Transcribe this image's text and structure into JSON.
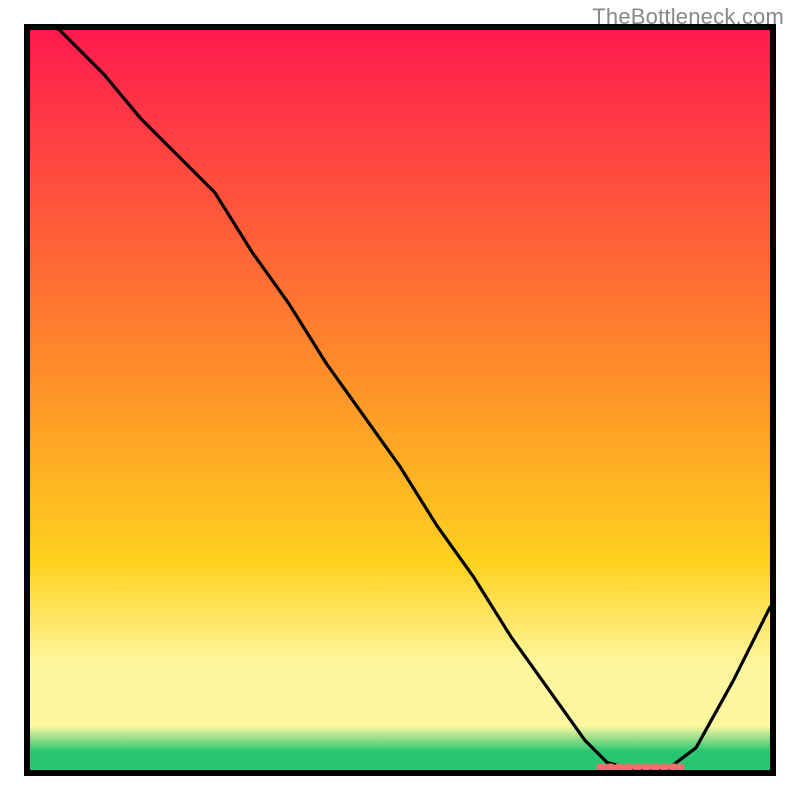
{
  "watermark": "TheBottleneck.com",
  "colors": {
    "gradient_top": "#FF1A4E",
    "gradient_mid1": "#FF8A2A",
    "gradient_mid2": "#FFD21E",
    "gradient_lower": "#FFF7A0",
    "gradient_green": "#28C76F",
    "curve": "#000000",
    "marker": "#EE706A",
    "frame": "#000000"
  },
  "chart_data": {
    "type": "line",
    "title": "",
    "xlabel": "",
    "ylabel": "",
    "xlim": [
      0,
      100
    ],
    "ylim": [
      0,
      100
    ],
    "x": [
      0,
      4,
      10,
      15,
      20,
      25,
      30,
      35,
      40,
      45,
      50,
      55,
      60,
      65,
      70,
      75,
      78,
      82,
      86,
      90,
      95,
      100
    ],
    "values": [
      103,
      100,
      94,
      88,
      83,
      78,
      70,
      63,
      55,
      48,
      41,
      33,
      26,
      18,
      11,
      4,
      1,
      0,
      0,
      3,
      12,
      22
    ],
    "marker_segment": {
      "x_from": 77,
      "x_to": 88,
      "y": 0
    },
    "gradient_stops_pct": [
      0,
      45,
      72,
      86,
      94,
      97.5,
      100
    ],
    "note": "x and values are in percent of the inner plot area; values>100 indicate the curve enters from above the top frame."
  },
  "plot_geometry": {
    "outer_w": 800,
    "outer_h": 800,
    "inner_x": 30,
    "inner_y": 30,
    "inner_w": 740,
    "inner_h": 740,
    "frame_stroke_w": 6
  }
}
